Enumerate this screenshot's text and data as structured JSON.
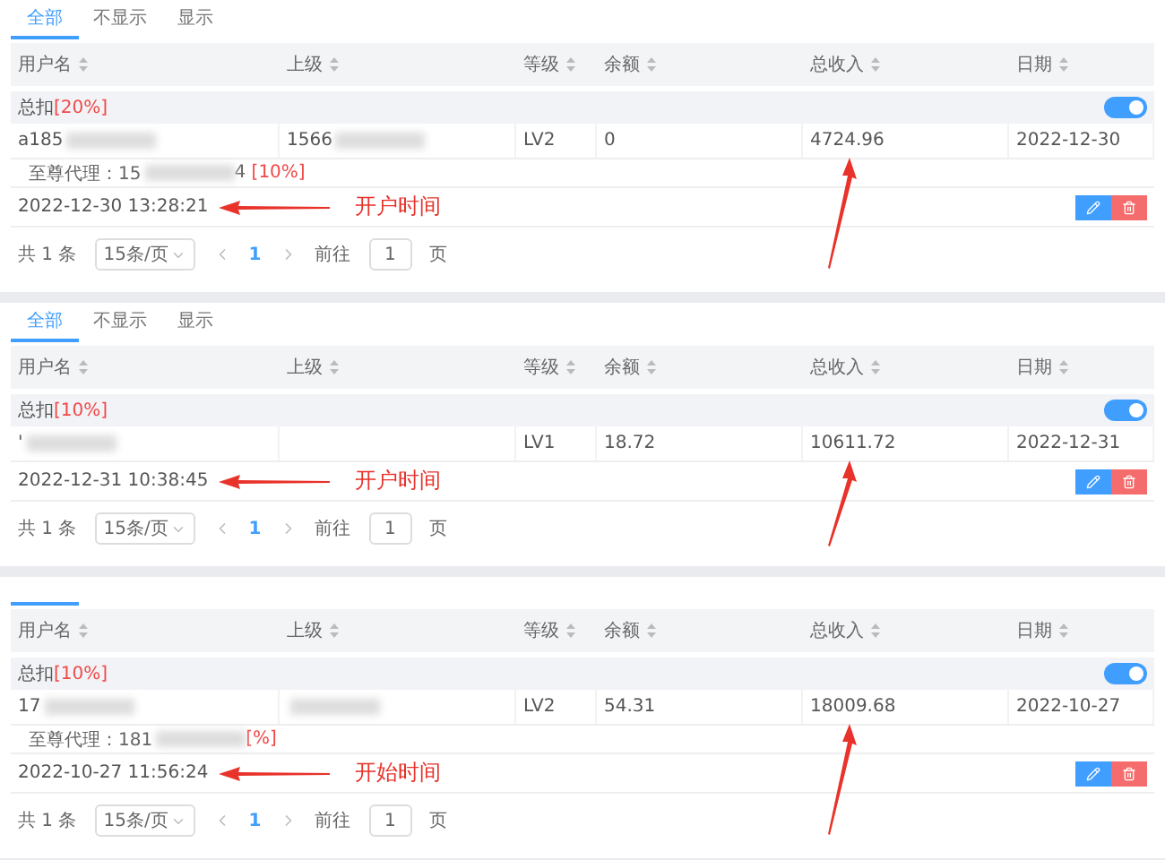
{
  "panels": [
    {
      "tabs": [
        {
          "label": "全部",
          "selected": true
        },
        {
          "label": "不显示",
          "selected": false
        },
        {
          "label": "显示",
          "selected": false
        }
      ],
      "columns": [
        "用户名",
        "上级",
        "等级",
        "余额",
        "总收入",
        "日期"
      ],
      "group": {
        "label": "总扣",
        "rate": "[20%]",
        "on": true
      },
      "cells": [
        {
          "text": "a185",
          "redacted": true
        },
        {
          "text": "1566",
          "redacted": true
        },
        {
          "text": "LV2"
        },
        {
          "text": "0"
        },
        {
          "text": "4724.96"
        },
        {
          "text": "2022-12-30"
        }
      ],
      "agent": {
        "label": "至尊代理：",
        "value": "15",
        "tail": "4",
        "rate": "[10%]"
      },
      "created": "2022-12-30 13:28:21",
      "annotation": "开户时间",
      "pagination": {
        "total": "共 1 条",
        "page_size": "15条/页",
        "page": "1",
        "goto": "前往",
        "goto_value": "1",
        "unit": "页"
      }
    },
    {
      "tabs": [
        {
          "label": "全部",
          "selected": true
        },
        {
          "label": "不显示",
          "selected": false
        },
        {
          "label": "显示",
          "selected": false
        }
      ],
      "columns": [
        "用户名",
        "上级",
        "等级",
        "余额",
        "总收入",
        "日期"
      ],
      "group": {
        "label": "总扣",
        "rate": "[10%]",
        "on": true
      },
      "cells": [
        {
          "text": "'",
          "redacted": true
        },
        {},
        {
          "text": "LV1"
        },
        {
          "text": "18.72"
        },
        {
          "text": "10611.72"
        },
        {
          "text": "2022-12-31"
        }
      ],
      "created": "2022-12-31 10:38:45",
      "annotation": "开户时间",
      "pagination": {
        "total": "共 1 条",
        "page_size": "15条/页",
        "page": "1",
        "goto": "前往",
        "goto_value": "1",
        "unit": "页"
      }
    },
    {
      "tabs": [
        {
          "selected": true
        }
      ],
      "columns": [
        "用户名",
        "上级",
        "等级",
        "余额",
        "总收入",
        "日期"
      ],
      "group": {
        "label": "总扣",
        "rate": "[10%]",
        "on": true
      },
      "cells": [
        {
          "text": "17",
          "redacted": true
        },
        {
          "redacted": true
        },
        {
          "text": "LV2"
        },
        {
          "text": "54.31"
        },
        {
          "text": "18009.68"
        },
        {
          "text": "2022-10-27"
        }
      ],
      "agent": {
        "label": "至尊代理：",
        "value": "181",
        "rate": "[%]"
      },
      "created": "2022-10-27 11:56:24",
      "annotation": "开始时间",
      "pagination": {
        "total": "共 1 条",
        "page_size": "15条/页",
        "page": "1",
        "goto": "前往",
        "goto_value": "1",
        "unit": "页"
      }
    }
  ]
}
